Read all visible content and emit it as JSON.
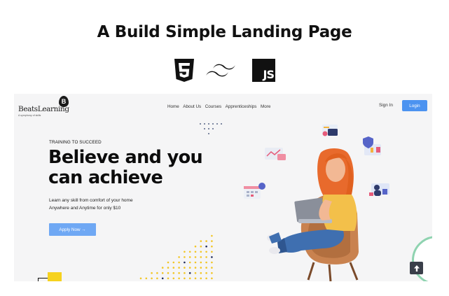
{
  "title": "A Build Simple Landing Page",
  "tech_icons": [
    "html5-icon",
    "tailwind-icon",
    "javascript-icon"
  ],
  "js_label": "JS",
  "site": {
    "logo": {
      "mark": "B",
      "name": "BeatsLearning",
      "tagline": "A symphony of skills"
    },
    "nav": [
      "Home",
      "About Us",
      "Courses",
      "Apprenticeships",
      "More"
    ],
    "signin": "Sign In",
    "login": "Login",
    "hero": {
      "kicker": "TRAINING TO SUCCEED",
      "headline_1": "Believe and you",
      "headline_2": "can achieve",
      "sub_1": "Learn any skill from comfort of your home",
      "sub_2": "Anywhere and Anytime for only $10",
      "cta": "Apply Now →"
    },
    "scroll_top_icon": "arrow-up-icon"
  },
  "colors": {
    "primary_blue": "#4c93f0",
    "cta_blue": "#6fa8f4",
    "accent_yellow": "#f6d21f",
    "hero_bg": "#f5f5f6",
    "character_orange": "#e86a2c"
  }
}
